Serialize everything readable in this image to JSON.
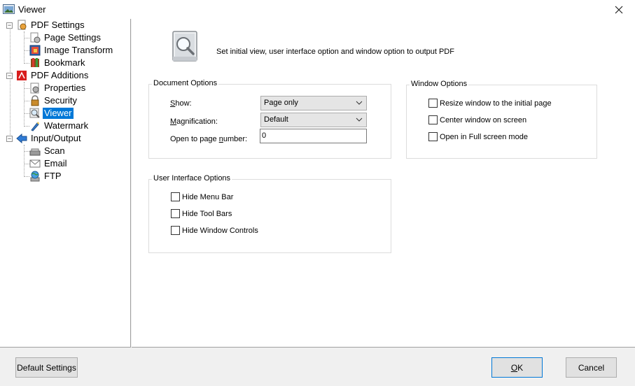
{
  "window": {
    "title": "Viewer"
  },
  "tree": {
    "items": [
      {
        "label": "PDF Settings"
      },
      {
        "label": "Page Settings"
      },
      {
        "label": "Image Transform"
      },
      {
        "label": "Bookmark"
      },
      {
        "label": "PDF Additions"
      },
      {
        "label": "Properties"
      },
      {
        "label": "Security"
      },
      {
        "label": "Viewer"
      },
      {
        "label": "Watermark"
      },
      {
        "label": "Input/Output"
      },
      {
        "label": "Scan"
      },
      {
        "label": "Email"
      },
      {
        "label": "FTP"
      }
    ],
    "selected": "Viewer"
  },
  "header": {
    "description": "Set initial view, user interface option and window option to output PDF"
  },
  "document_options": {
    "legend": "Document Options",
    "show_label_pre": "S",
    "show_label_post": "how:",
    "show_value": "Page only",
    "magnification_label_pre": "M",
    "magnification_label_post": "agnification:",
    "magnification_value": "Default",
    "open_page_label_pre": "Open to page ",
    "open_page_label_u": "n",
    "open_page_label_post": "umber:",
    "open_page_value": "0"
  },
  "window_options": {
    "legend": "Window Options",
    "items": [
      {
        "label": "Resize window to the initial page",
        "checked": false
      },
      {
        "label": "Center window on screen",
        "checked": false
      },
      {
        "label": "Open in Full screen mode",
        "checked": false
      }
    ]
  },
  "ui_options": {
    "legend": "User Interface Options",
    "items": [
      {
        "label": "Hide Menu Bar",
        "checked": false
      },
      {
        "label": "Hide Tool Bars",
        "checked": false
      },
      {
        "label": "Hide Window Controls",
        "checked": false
      }
    ]
  },
  "buttons": {
    "default_settings": "Default Settings",
    "ok_u": "O",
    "ok_post": "K",
    "cancel": "Cancel"
  },
  "colors": {
    "selection": "#0078d7",
    "window_bg": "#f0f0f0",
    "panel_bg": "#ffffff"
  },
  "icons": {
    "title": "viewer-app-icon",
    "close": "close-icon",
    "header": "magnifier-document-icon"
  }
}
